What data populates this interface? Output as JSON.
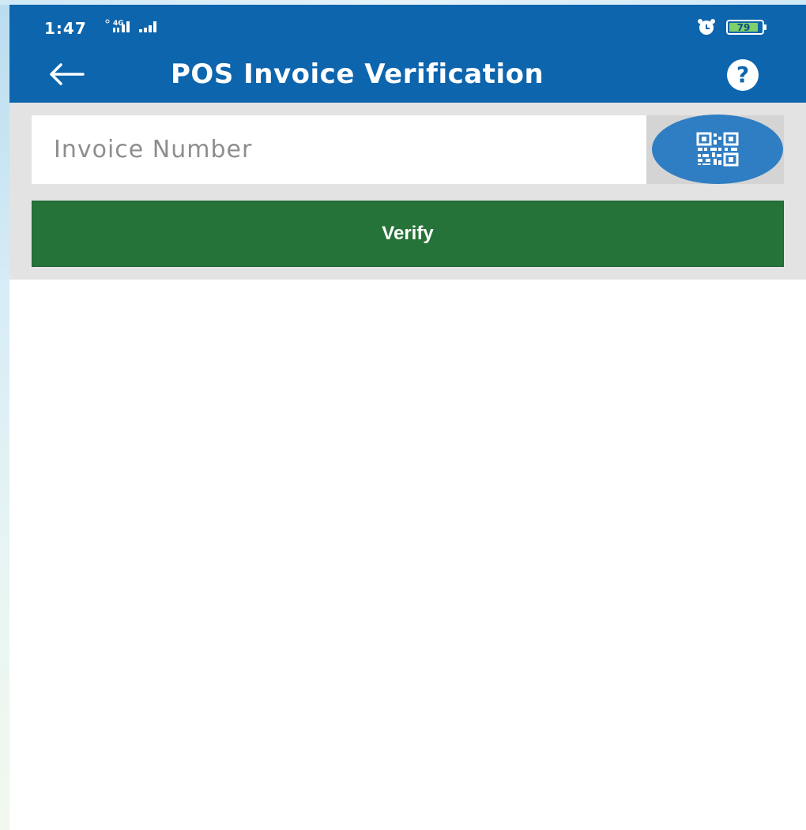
{
  "status_bar": {
    "time": "1:47",
    "network": "4G",
    "battery": "79",
    "icons": [
      "signal-4g-icon",
      "signal-icon",
      "alarm-icon",
      "battery-icon"
    ]
  },
  "app_bar": {
    "title": "POS Invoice Verification",
    "back_icon": "arrow-left-icon",
    "help_icon": "help-circle-icon",
    "help_glyph": "?",
    "background_color": "#0d65ad"
  },
  "form": {
    "invoice_input": {
      "placeholder": "Invoice Number",
      "value": ""
    },
    "scan_icon": "qr-code-icon",
    "verify_label": "Verify",
    "verify_color": "#267339"
  }
}
